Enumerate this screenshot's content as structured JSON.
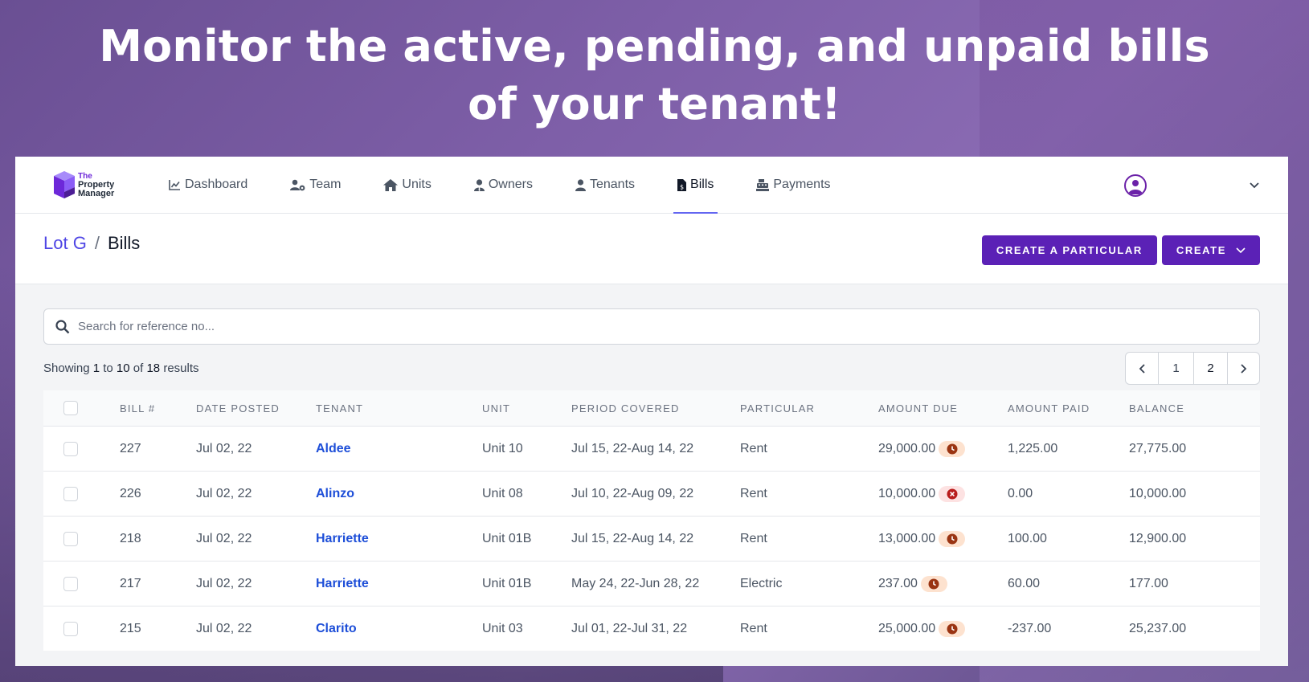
{
  "headline": "Monitor the active, pending, and unpaid bills of your tenant!",
  "brand": {
    "line1": "The",
    "line2": "Property",
    "line3": "Manager"
  },
  "nav": {
    "items": [
      {
        "label": "Dashboard",
        "icon": "chart-line-icon"
      },
      {
        "label": "Team",
        "icon": "users-cog-icon"
      },
      {
        "label": "Units",
        "icon": "home-icon"
      },
      {
        "label": "Owners",
        "icon": "user-tie-icon"
      },
      {
        "label": "Tenants",
        "icon": "user-icon"
      },
      {
        "label": "Bills",
        "icon": "file-invoice-icon",
        "active": true
      },
      {
        "label": "Payments",
        "icon": "cash-register-icon"
      }
    ]
  },
  "breadcrumb": {
    "parent": "Lot G",
    "separator": "/",
    "current": "Bills"
  },
  "actions": {
    "create_particular": "CREATE A PARTICULAR",
    "create": "CREATE"
  },
  "search": {
    "placeholder": "Search for reference no..."
  },
  "results": {
    "prefix": "Showing",
    "from": "1",
    "to_word": "to",
    "to": "10",
    "of_word": "of",
    "total": "18",
    "suffix": "results"
  },
  "pagination": {
    "pages": [
      "1",
      "2"
    ]
  },
  "table": {
    "headers": [
      "BILL #",
      "DATE POSTED",
      "TENANT",
      "UNIT",
      "PERIOD COVERED",
      "PARTICULAR",
      "AMOUNT DUE",
      "AMOUNT PAID",
      "BALANCE"
    ],
    "rows": [
      {
        "bill": "227",
        "date": "Jul 02, 22",
        "tenant": "Aldee",
        "unit": "Unit 10",
        "period": "Jul 15, 22-Aug 14, 22",
        "particular": "Rent",
        "due": "29,000.00",
        "status": "pending-clock-icon",
        "paid": "1,225.00",
        "balance": "27,775.00"
      },
      {
        "bill": "226",
        "date": "Jul 02, 22",
        "tenant": "Alinzo",
        "unit": "Unit 08",
        "period": "Jul 10, 22-Aug 09, 22",
        "particular": "Rent",
        "due": "10,000.00",
        "status": "unpaid-x-icon",
        "paid": "0.00",
        "balance": "10,000.00"
      },
      {
        "bill": "218",
        "date": "Jul 02, 22",
        "tenant": "Harriette",
        "unit": "Unit 01B",
        "period": "Jul 15, 22-Aug 14, 22",
        "particular": "Rent",
        "due": "13,000.00",
        "status": "pending-clock-icon",
        "paid": "100.00",
        "balance": "12,900.00"
      },
      {
        "bill": "217",
        "date": "Jul 02, 22",
        "tenant": "Harriette",
        "unit": "Unit 01B",
        "period": "May 24, 22-Jun 28, 22",
        "particular": "Electric",
        "due": "237.00",
        "status": "pending-clock-icon",
        "paid": "60.00",
        "balance": "177.00"
      },
      {
        "bill": "215",
        "date": "Jul 02, 22",
        "tenant": "Clarito",
        "unit": "Unit 03",
        "period": "Jul 01, 22-Jul 31, 22",
        "particular": "Rent",
        "due": "25,000.00",
        "status": "pending-clock-icon",
        "paid": "-237.00",
        "balance": "25,237.00"
      }
    ]
  },
  "colors": {
    "primary": "#5b21b6",
    "link": "#1d4ed8",
    "crumb": "#4f46e5",
    "pending": "#9a3412",
    "unpaid": "#b91c1c"
  }
}
